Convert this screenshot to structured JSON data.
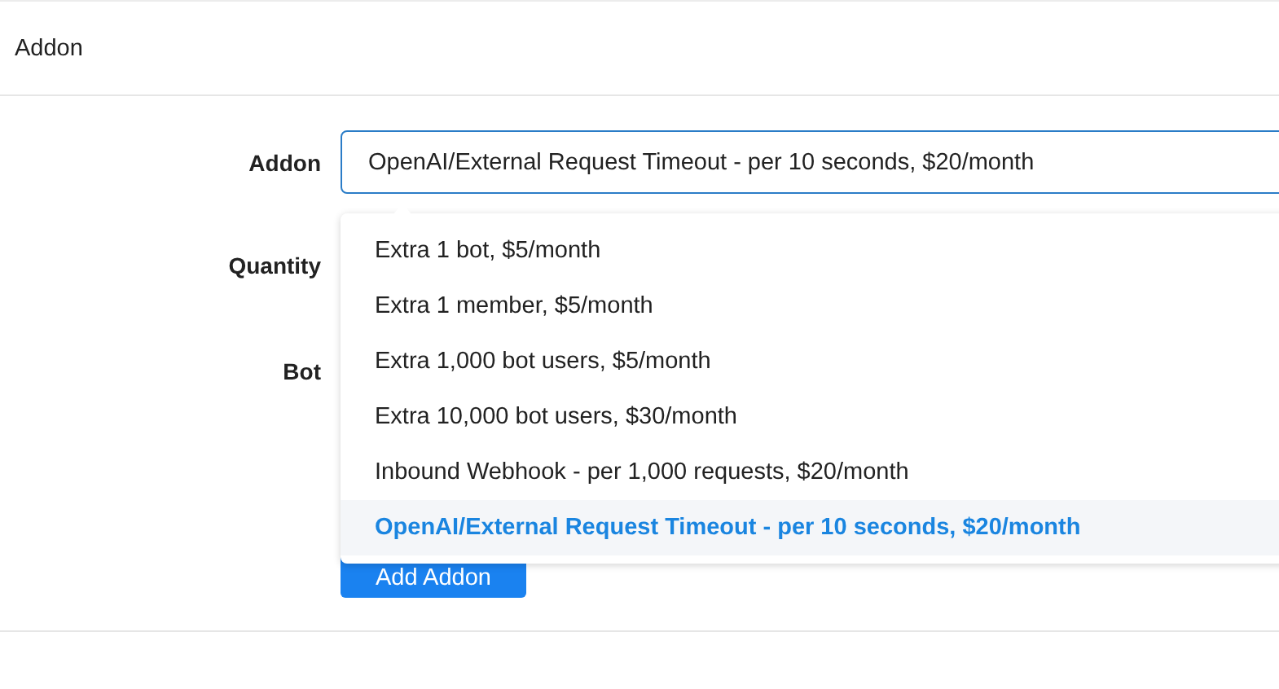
{
  "header": {
    "title": "Addon"
  },
  "form": {
    "addon": {
      "label": "Addon",
      "value": "OpenAI/External Request Timeout - per 10 seconds, $20/month"
    },
    "quantity": {
      "label": "Quantity"
    },
    "bot": {
      "label": "Bot"
    },
    "submit_button": "Add Addon"
  },
  "dropdown": {
    "options": [
      {
        "label": "Extra 1 bot, $5/month",
        "selected": false
      },
      {
        "label": "Extra 1 member, $5/month",
        "selected": false
      },
      {
        "label": "Extra 1,000 bot users, $5/month",
        "selected": false
      },
      {
        "label": "Extra 10,000 bot users, $30/month",
        "selected": false
      },
      {
        "label": "Inbound Webhook - per 1,000 requests, $20/month",
        "selected": false
      },
      {
        "label": "OpenAI/External Request Timeout - per 10 seconds, $20/month",
        "selected": true
      }
    ]
  }
}
